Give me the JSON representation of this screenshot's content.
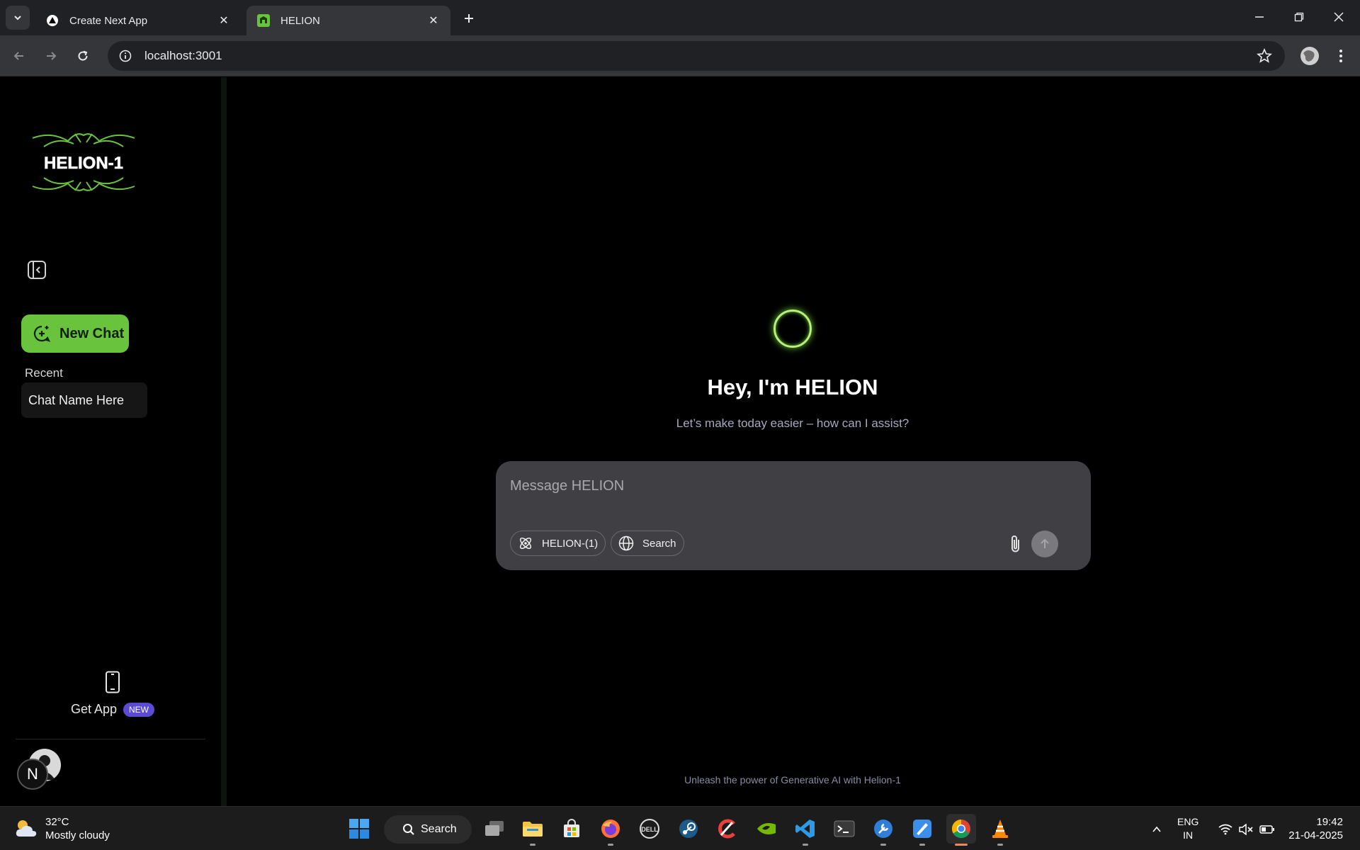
{
  "browser": {
    "tabs": [
      {
        "title": "Create Next App",
        "favicon": "nextjs-triangle-icon"
      },
      {
        "title": "HELION",
        "favicon": "helion-favicon-icon"
      }
    ],
    "url": "localhost:3001"
  },
  "sidebar": {
    "logo_text": "HELION-1",
    "new_chat_label": "New Chat",
    "recent_label": "Recent",
    "recent_chats": [
      {
        "title": "Chat Name Here"
      }
    ],
    "get_app_label": "Get App",
    "get_app_badge": "NEW",
    "user_initial": "N"
  },
  "main": {
    "greeting": "Hey, I'm HELION",
    "subtitle": "Let’s make today easier – how can I assist?",
    "composer": {
      "placeholder": "Message HELION",
      "model_pill": "HELION-(1)",
      "search_pill": "Search"
    },
    "footer_note": "Unleash the power of Generative AI with Helion-1"
  },
  "taskbar": {
    "weather_temp": "32°C",
    "weather_desc": "Mostly cloudy",
    "search_label": "Search",
    "lang_line1": "ENG",
    "lang_line2": "IN",
    "time": "19:42",
    "date": "21-04-2025"
  },
  "colors": {
    "accent_green": "#6ac33c",
    "badge_purple": "#5b4bd3",
    "composer_bg": "#404044"
  }
}
